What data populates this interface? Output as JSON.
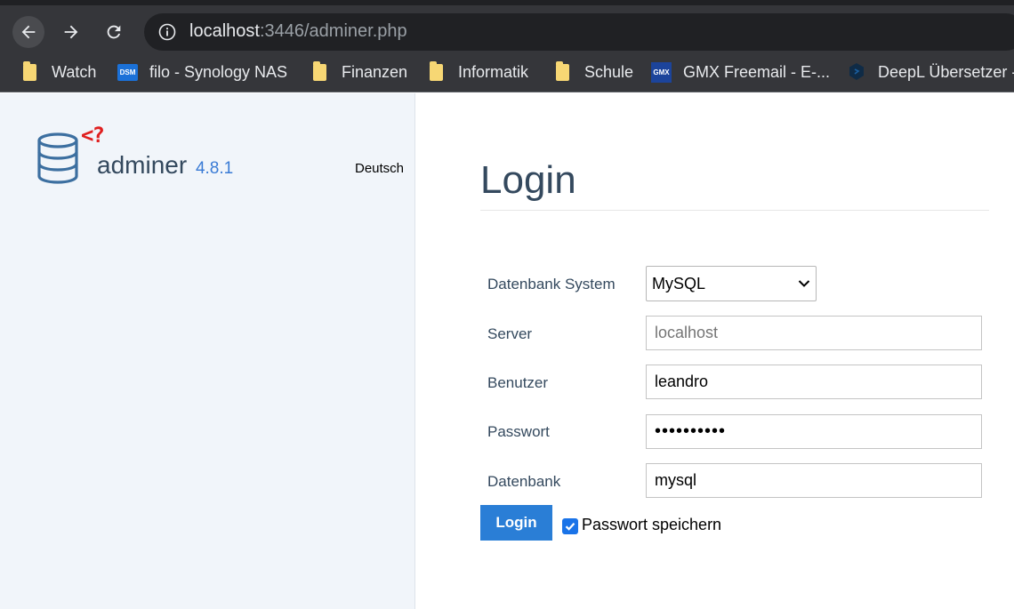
{
  "browser": {
    "url_host": "localhost",
    "url_path": ":3446/adminer.php",
    "bookmarks": [
      {
        "label": "Watch",
        "icon": "folder-icon"
      },
      {
        "label": "filo - Synology NAS",
        "icon": "synology-dsm-icon",
        "badge": "DSM"
      },
      {
        "label": "Finanzen",
        "icon": "folder-icon"
      },
      {
        "label": "Informatik",
        "icon": "folder-icon"
      },
      {
        "label": "Schule",
        "icon": "folder-icon"
      },
      {
        "label": "GMX Freemail - E-...",
        "icon": "gmx-icon",
        "badge": "GMX"
      },
      {
        "label": "DeepL Übersetzer -",
        "icon": "deepl-icon"
      }
    ]
  },
  "sidebar": {
    "logo_tag": "<?",
    "brand": "adminer",
    "version": "4.8.1",
    "language": "Deutsch"
  },
  "form": {
    "title": "Login",
    "system_label": "Datenbank System",
    "system_value": "MySQL",
    "server_label": "Server",
    "server_placeholder": "localhost",
    "user_label": "Benutzer",
    "user_value": "leandro",
    "password_label": "Passwort",
    "password_value": "••••••••••",
    "db_label": "Datenbank",
    "db_value": "mysql",
    "login_button": "Login",
    "remember_label": "Passwort speichern",
    "remember_checked": true
  },
  "colors": {
    "accent": "#2a7ed6",
    "sidebar_bg": "#f1f5fa",
    "text": "#34495e",
    "logo_red": "#e01f1f"
  }
}
